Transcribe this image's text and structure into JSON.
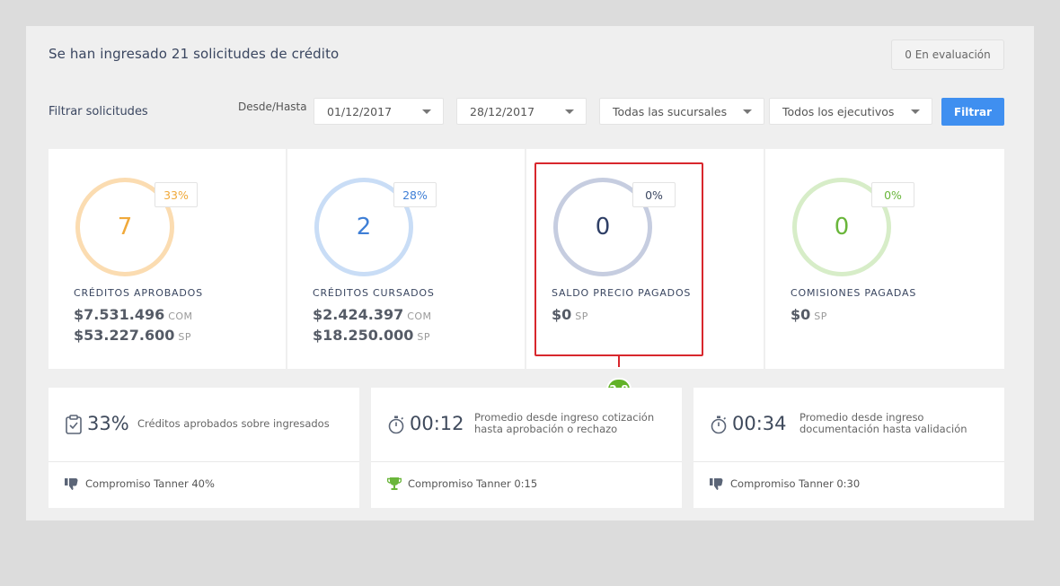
{
  "header": {
    "title": "Se han ingresado 21 solicitudes de crédito",
    "eval_badge": "0 En evaluación"
  },
  "filters": {
    "label": "Filtrar solicitudes",
    "range_label": "Desde/Hasta",
    "from": "01/12/2017",
    "to": "28/12/2017",
    "branch": "Todas las sucursales",
    "executive": "Todos los ejecutivos",
    "button": "Filtrar"
  },
  "stats": [
    {
      "value": "7",
      "percent": "33%",
      "label": "CRÉDITOS APROBADOS",
      "line1": "$7.531.496",
      "line1_suffix": "COM",
      "line2": "$53.227.600",
      "line2_suffix": "SP",
      "color": "#f0a93a",
      "ring": "#fbdcb1"
    },
    {
      "value": "2",
      "percent": "28%",
      "label": "CRÉDITOS CURSADOS",
      "line1": "$2.424.397",
      "line1_suffix": "COM",
      "line2": "$18.250.000",
      "line2_suffix": "SP",
      "color": "#3f7fd6",
      "ring": "#c9ddf6"
    },
    {
      "value": "0",
      "percent": "0%",
      "label": "SALDO PRECIO PAGADOS",
      "line1": "$0",
      "line1_suffix": "SP",
      "color": "#2f3f66",
      "ring": "#c6cde0"
    },
    {
      "value": "0",
      "percent": "0%",
      "label": "COMISIONES PAGADAS",
      "line1": "$0",
      "line1_suffix": "SP",
      "color": "#6ab63b",
      "ring": "#d7edc8"
    }
  ],
  "annotation": {
    "step": "2.8"
  },
  "kpis": [
    {
      "big": "33%",
      "desc1": "Créditos aprobados sobre ingresados",
      "desc2": "",
      "icon": "clipboard-check-icon",
      "footer": "Compromiso Tanner 40%",
      "footer_icon": "thumbs-down-icon"
    },
    {
      "big": "00:12",
      "desc1": "Promedio desde ingreso cotización",
      "desc2": "hasta aprobación o rechazo",
      "icon": "stopwatch-icon",
      "footer": "Compromiso Tanner 0:15",
      "footer_icon": "trophy-icon"
    },
    {
      "big": "00:34",
      "desc1": "Promedio desde ingreso",
      "desc2": "documentación hasta validación",
      "icon": "stopwatch-icon",
      "footer": "Compromiso Tanner 0:30",
      "footer_icon": "thumbs-down-icon"
    }
  ]
}
